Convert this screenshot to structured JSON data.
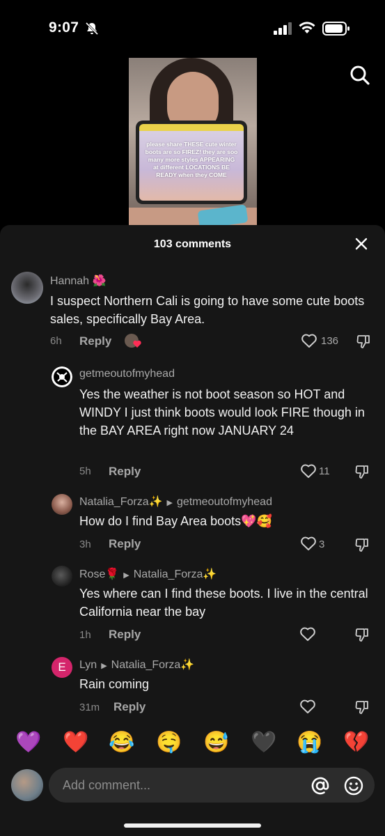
{
  "status_bar": {
    "time": "9:07"
  },
  "video": {
    "overlay_text": "please share THESE cute winter boots are so FIREZ! they are soo many more styles APPEARING at different LOCATIONS BE READY when they COME"
  },
  "comments_sheet": {
    "title": "103 comments",
    "comments": [
      {
        "username": "Hannah 🌺",
        "text": "I suspect Northern Cali is going to have some cute boots sales, specifically Bay Area.",
        "time": "6h",
        "reply_label": "Reply",
        "likes": "136"
      },
      {
        "username": "getmeoutofmyhead",
        "text": "Yes the weather is not boot season so HOT and WINDY I just think boots would look FIRE though in the BAY AREA right now JANUARY 24",
        "time": "5h",
        "reply_label": "Reply",
        "likes": "11"
      },
      {
        "username": "Natalia_Forza✨",
        "reply_to": "getmeoutofmyhead",
        "text": "How do I find Bay Area boots💖🥰",
        "time": "3h",
        "reply_label": "Reply",
        "likes": "3"
      },
      {
        "username": "Rose🌹",
        "reply_to": "Natalia_Forza✨",
        "text": "Yes where can I find these boots. I live in the central California near the bay",
        "time": "1h",
        "reply_label": "Reply",
        "likes": ""
      },
      {
        "username": "Lyn",
        "avatar_letter": "E",
        "reply_to": "Natalia_Forza✨",
        "text": "Rain coming",
        "time": "31m",
        "reply_label": "Reply",
        "likes": ""
      }
    ]
  },
  "emoji_bar": [
    "💜",
    "❤️",
    "😂",
    "🤤",
    "😅",
    "🖤",
    "😭",
    "💔"
  ],
  "comment_input": {
    "placeholder": "Add comment..."
  },
  "colors": {
    "sheet_bg": "#161616",
    "input_bg": "#2c2c2c",
    "lyn_avatar": "#d4256b"
  }
}
